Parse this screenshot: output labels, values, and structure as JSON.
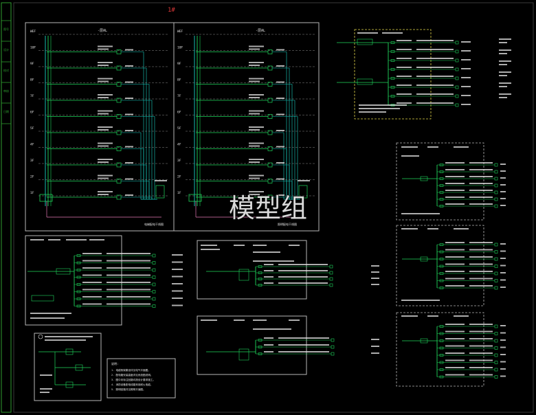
{
  "sheet_title": "1#",
  "watermark": "模型组",
  "colors": {
    "background": "#000000",
    "frame": "#b8b8b8",
    "bus": "#19d3c5",
    "wire": "#1fd85c",
    "label": "#e8e8e8",
    "yellow": "#e6d94a",
    "red": "#e03a3a",
    "pink": "#e57ab5",
    "sidebar": "#2f9e2f"
  },
  "riser_left": {
    "floors": [
      "WEF",
      "10F",
      "9F",
      "8F",
      "7F",
      "6F",
      "5F",
      "4F",
      "3F",
      "2F",
      "1F"
    ],
    "header": "-层AL",
    "caption": "电梯配电干线图"
  },
  "riser_right": {
    "floors": [
      "WEF",
      "10F",
      "9F",
      "8F",
      "7F",
      "6F",
      "5F",
      "4F",
      "3F",
      "2F",
      "1F"
    ],
    "header": "-层AL",
    "caption": "照明配电干线图"
  },
  "notes": {
    "title": "说明:",
    "lines": [
      "1. 电缆桥架敷设详见电气平面图。",
      "2. 配电箱安装高度详见系统图说明。",
      "3. 图中未标注回路均按设计要求施工。",
      "4. 消防设备配电线路采用耐火电缆。",
      "5. 照明回路详见照明平面图。"
    ]
  },
  "panels": {
    "top_right": "AL-WD 配电箱系统图",
    "mid_left": "AL-1F 配电箱系统图",
    "mid_center": "AP-1 配电箱系统图",
    "bottom_center": "AP-2 配电箱系统图",
    "bottom_left": "应急照明配电箱",
    "right_1": "ALE-1 系统图",
    "right_2": "ALE-2 系统图",
    "right_3": "ALE-3 系统图"
  },
  "sidebar_labels": [
    "图号",
    "设计",
    "校对",
    "审核",
    "日期"
  ]
}
